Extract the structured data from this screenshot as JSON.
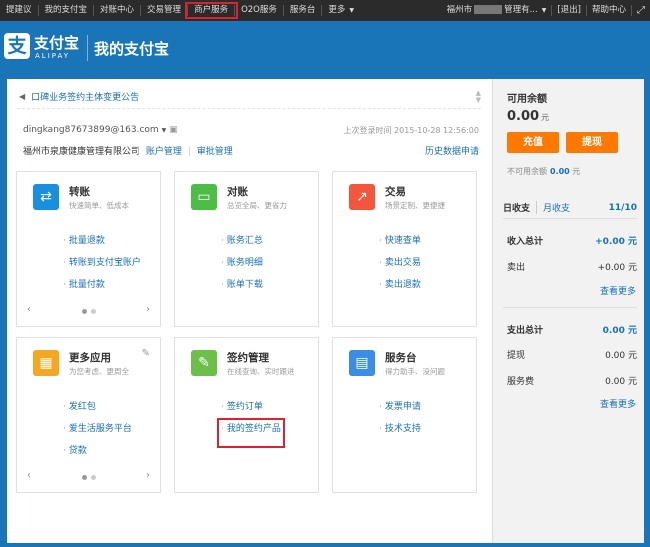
{
  "topbar": {
    "nav": [
      "提建议",
      "我的支付宝",
      "对账中心",
      "交易管理",
      "商户服务",
      "O2O服务",
      "服务台",
      "更多"
    ],
    "city_prefix": "福州市",
    "company_short": "管理有...",
    "logout": "[退出]",
    "help": "帮助中心"
  },
  "header": {
    "logo_char": "支",
    "logo_name": "支付宝",
    "logo_sub": "ALIPAY",
    "page_title": "我的支付宝"
  },
  "notice": {
    "text": "口碑业务签约主体变更公告"
  },
  "account": {
    "email": "dingkang87673899@163.com",
    "last_login": "上次登录时间 2015-10-28 12:56:00",
    "company": "福州市泉康健康管理有限公司",
    "link_account": "账户管理",
    "link_audit": "审批管理",
    "history": "历史数据申请"
  },
  "cards": [
    {
      "title": "转账",
      "desc": "快速简单、低成本",
      "icon": "⇄",
      "color": "#1a8fe0",
      "items": [
        "批量退款",
        "转账到支付宝账户",
        "批量付款"
      ]
    },
    {
      "title": "对账",
      "desc": "总览全局、更省力",
      "icon": "▭",
      "color": "#4dbd47",
      "items": [
        "账务汇总",
        "账务明细",
        "账单下载"
      ]
    },
    {
      "title": "交易",
      "desc": "场景定制、更便捷",
      "icon": "↗",
      "color": "#f2573e",
      "items": [
        "快速查单",
        "卖出交易",
        "卖出退款"
      ]
    },
    {
      "title": "更多应用",
      "desc": "为您考虑、更周全",
      "icon": "▦",
      "color": "#f5a623",
      "items": [
        "发红包",
        "爱生活服务平台",
        "贷款"
      ]
    },
    {
      "title": "签约管理",
      "desc": "在线查询、实时跟进",
      "icon": "✎",
      "color": "#6cc04a",
      "items": [
        "签约订单",
        "我的签约产品"
      ]
    },
    {
      "title": "服务台",
      "desc": "得力助手、没问题",
      "icon": "▤",
      "color": "#3a8ee6",
      "items": [
        "发票申请",
        "技术支持"
      ]
    }
  ],
  "sidebar": {
    "balance_label": "可用余额",
    "balance": "0.00",
    "unit": "元",
    "recharge": "充值",
    "withdraw": "提现",
    "unavailable_label": "不可用余额",
    "unavailable": "0.00",
    "tab_day": "日收支",
    "tab_month": "月收支",
    "page": "11/10",
    "income_total_label": "收入总计",
    "income_total": "+0.00 元",
    "sold_label": "卖出",
    "sold": "+0.00 元",
    "more": "查看更多",
    "expense_total_label": "支出总计",
    "expense_total": "0.00 元",
    "withdraw_label": "提现",
    "withdraw_val": "0.00 元",
    "fee_label": "服务费",
    "fee_val": "0.00 元"
  }
}
